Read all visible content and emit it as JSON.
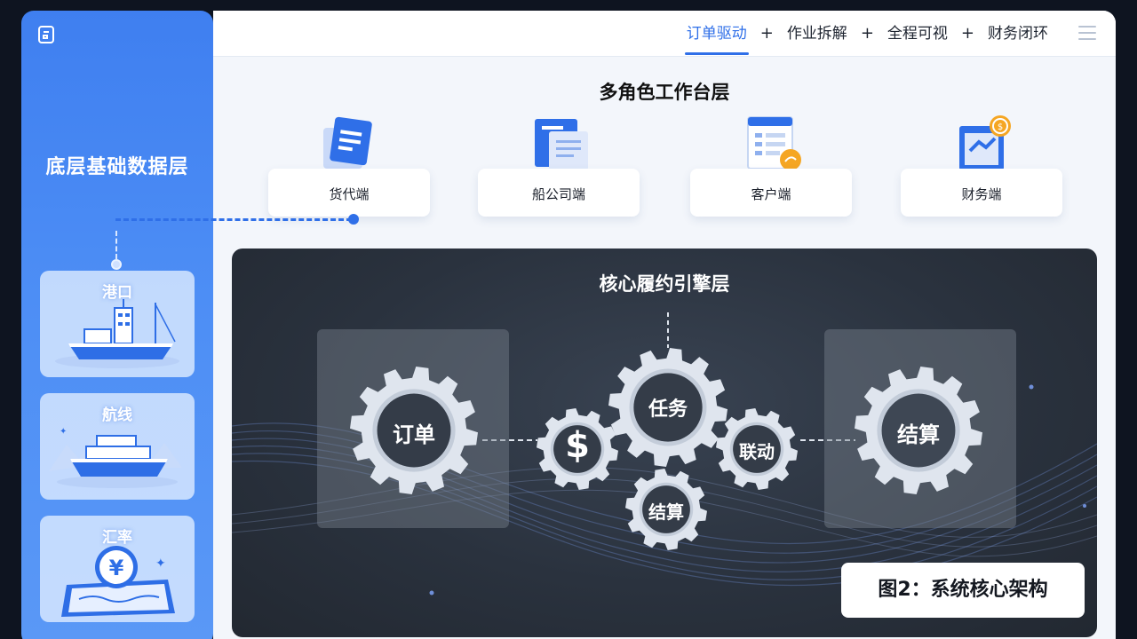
{
  "sidebar": {
    "title": "底层基础数据层",
    "cards": [
      {
        "label": "港口",
        "icon": "port-ship-icon"
      },
      {
        "label": "航线",
        "icon": "route-ship-icon"
      },
      {
        "label": "汇率",
        "icon": "exchange-rate-yuan-icon"
      }
    ]
  },
  "topnav": {
    "items": [
      {
        "label": "订单驱动",
        "active": true
      },
      {
        "label": "作业拆解",
        "active": false
      },
      {
        "label": "全程可视",
        "active": false
      },
      {
        "label": "财务闭环",
        "active": false
      }
    ],
    "separator": "+"
  },
  "workbench": {
    "title": "多角色工作台层",
    "roles": [
      {
        "label": "货代端",
        "icon": "document-icon"
      },
      {
        "label": "船公司端",
        "icon": "files-icon"
      },
      {
        "label": "客户端",
        "icon": "form-icon"
      },
      {
        "label": "财务端",
        "icon": "finance-icon"
      }
    ]
  },
  "core": {
    "title": "核心履约引擎层",
    "left_gear": "订单",
    "right_gear": "结算",
    "center_gears": {
      "dollar": "$",
      "task": "任务",
      "link": "联动",
      "settle": "结算"
    }
  },
  "caption": "图2：系统核心架构",
  "colors": {
    "accent": "#2f6fe8",
    "sidebar": "#4d8ef5",
    "core_bg": "#2a323e",
    "gear": "#dfe5ee"
  }
}
